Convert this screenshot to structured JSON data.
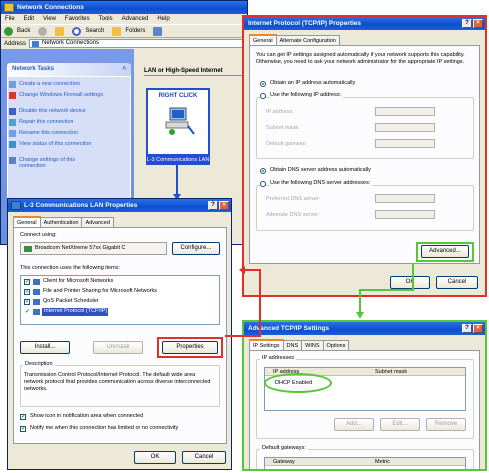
{
  "nc": {
    "title": "Network Connections",
    "menus": [
      "File",
      "Edit",
      "View",
      "Favorites",
      "Tools",
      "Advanced",
      "Help"
    ],
    "back": "Back",
    "search": "Search",
    "folders": "Folders",
    "address_label": "Address",
    "address_value": "Network Connections",
    "network_tasks": "Network Tasks",
    "tasks": [
      "Create a new connection",
      "Change Windows Firewall settings",
      "Disable this network device",
      "Repair this connection",
      "Rename this connection",
      "View status of this connection",
      "Change settings of this connection"
    ],
    "section_header": "LAN or High-Speed Internet",
    "right_click": "RIGHT CLICK",
    "conn_caption": "L-3 Communications LAN"
  },
  "lan": {
    "title": "L-3 Communications LAN Properties",
    "tabs": [
      "General",
      "Authentication",
      "Advanced"
    ],
    "connect_using": "Connect using:",
    "adapter": "Broadcom NetXtreme 57xx Gigabit C",
    "configure": "Configure...",
    "items_label": "This connection uses the following items:",
    "items": [
      "Client for Microsoft Networks",
      "File and Printer Sharing for Microsoft Networks",
      "QoS Packet Scheduler",
      "Internet Protocol (TCP/IP)"
    ],
    "install": "Install...",
    "uninstall": "Uninstall",
    "properties": "Properties",
    "description_label": "Description",
    "description": "Transmission Control Protocol/Internet Protocol. The default wide area network protocol that provides communication across diverse interconnected networks.",
    "show_icon": "Show icon in notification area when connected",
    "notify": "Notify me when this connection has limited or no connectivity",
    "ok": "OK",
    "cancel": "Cancel"
  },
  "tcp": {
    "title": "Internet Protocol (TCP/IP) Properties",
    "tabs": [
      "General",
      "Alternate Configuration"
    ],
    "intro": "You can get IP settings assigned automatically if your network supports this capability. Otherwise, you need to ask your network administrator for the appropriate IP settings.",
    "obtain_ip": "Obtain an IP address automatically",
    "use_ip": "Use the following IP address:",
    "ip_fields": [
      "IP address:",
      "Subnet mask:",
      "Default gateway:"
    ],
    "obtain_dns": "Obtain DNS server address automatically",
    "use_dns": "Use the following DNS server addresses:",
    "dns_fields": [
      "Preferred DNS server:",
      "Alternate DNS server:"
    ],
    "advanced": "Advanced...",
    "ok": "OK",
    "cancel": "Cancel"
  },
  "adv": {
    "title": "Advanced TCP/IP Settings",
    "tabs": [
      "IP Settings",
      "DNS",
      "WINS",
      "Options"
    ],
    "ip_addresses": "IP addresses",
    "col_ip": "IP address",
    "col_mask": "Subnet mask",
    "dhcp": "DHCP Enabled",
    "add": "Add...",
    "edit": "Edit...",
    "remove": "Remove",
    "gateways": "Default gateways:",
    "col_gateway": "Gateway",
    "col_metric": "Metric"
  },
  "colors": {
    "xp_blue": "#0a4fd0",
    "callout_red": "#e0302a",
    "callout_green": "#56c838",
    "arrow_blue": "#2050d0"
  }
}
